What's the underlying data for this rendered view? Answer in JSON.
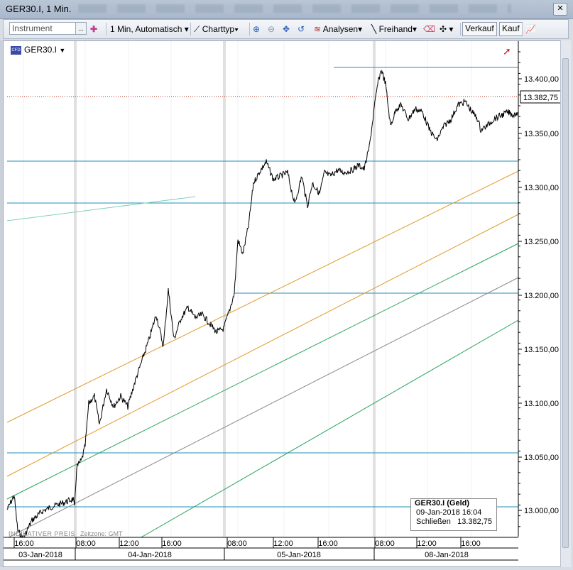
{
  "window": {
    "title": "GER30.I, 1 Min."
  },
  "toolbar": {
    "instrument_placeholder": "Instrument",
    "instrument_dropdown": "...",
    "interval": "1 Min,",
    "mode": "Automatisch",
    "charttype": "Charttyp",
    "analyses": "Analysen",
    "freehand": "Freihand",
    "sell": "Verkauf",
    "buy": "Kauf"
  },
  "chart": {
    "instrument": "GER30.I",
    "current_price_label": "13.382,75",
    "watermark": "INDIKATIVER PREIS",
    "timezone": "Zeitzone: GMT",
    "y_ticks": [
      "13.400,00",
      "13.350,00",
      "13.300,00",
      "13.250,00",
      "13.200,00",
      "13.150,00",
      "13.100,00",
      "13.050,00",
      "13.000,00"
    ],
    "time_ticks": [
      "16:00",
      "08:00",
      "12:00",
      "16:00",
      "08:00",
      "12:00",
      "16:00",
      "08:00",
      "12:00",
      "16:00"
    ],
    "date_labels": [
      "03-Jan-2018",
      "04-Jan-2018",
      "05-Jan-2018",
      "08-Jan-2018"
    ],
    "info_box": {
      "title": "GER30.I (Geld)",
      "datetime": "09-Jan-2018 16:04",
      "close_label": "Schließen",
      "close_value": "13.382,75"
    }
  },
  "colors": {
    "price_line": "#000000",
    "hline": "#1f8fb8",
    "orange": "#e09a2a",
    "green": "#22a05a",
    "gray": "#8a8a8a",
    "current_price": "#b03020"
  }
}
